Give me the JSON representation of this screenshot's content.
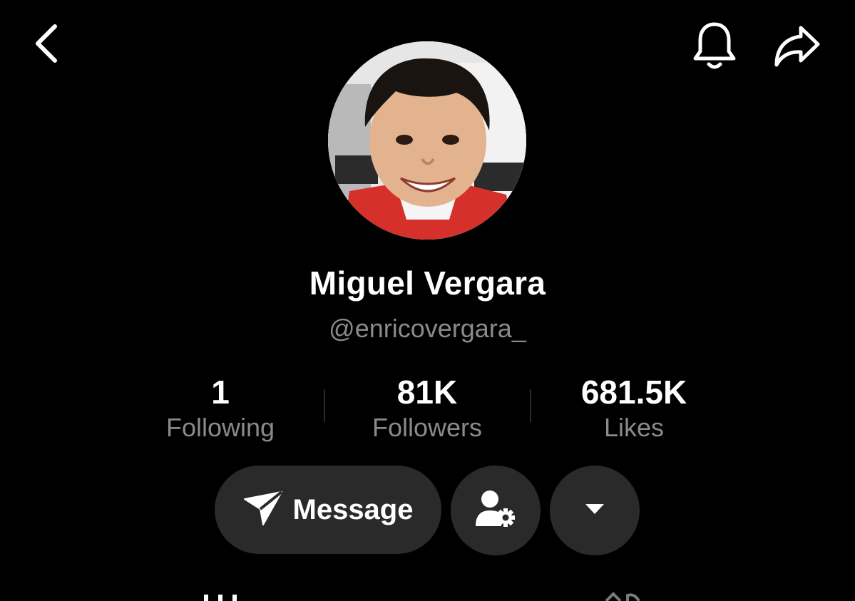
{
  "header": {
    "back_icon": "chevron-left-icon",
    "bell_icon": "bell-icon",
    "share_icon": "share-arrow-icon"
  },
  "profile": {
    "display_name": "Miguel Vergara",
    "username": "@enricovergara_",
    "avatar": "profile-photo"
  },
  "stats": [
    {
      "value": "1",
      "label": "Following"
    },
    {
      "value": "81K",
      "label": "Followers"
    },
    {
      "value": "681.5K",
      "label": "Likes"
    }
  ],
  "actions": {
    "message_label": "Message",
    "message_icon": "send-icon",
    "friend_icon": "user-settings-icon",
    "more_icon": "caret-down-icon"
  },
  "colors": {
    "background": "#000000",
    "button_bg": "#2a2a2a",
    "secondary_text": "#8a8a8a",
    "primary_text": "#ffffff"
  }
}
